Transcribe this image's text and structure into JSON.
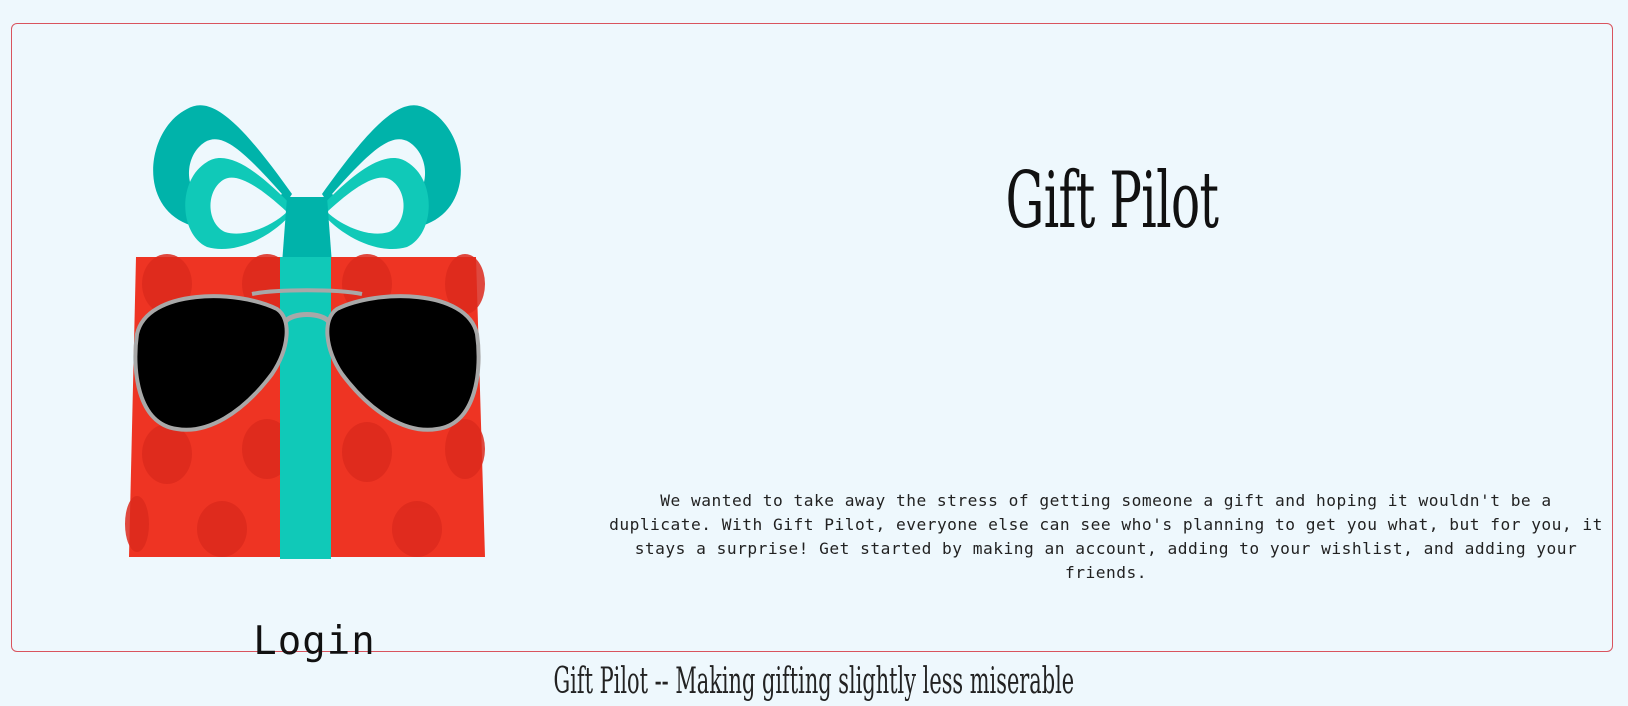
{
  "header": {
    "title": "Gift Pilot"
  },
  "main": {
    "description": "We wanted to take away the stress of getting someone a gift and hoping it wouldn't be a duplicate. With Gift Pilot, everyone else can see who's planning to get you what, but for you, it stays a surprise! Get started by making an account, adding to your wishlist, and adding your friends.",
    "login_label": "Login",
    "logo_icon": "gift-with-sunglasses-icon"
  },
  "footer": {
    "tagline": "Gift Pilot -- Making gifting slightly less miserable"
  },
  "colors": {
    "background": "#eef8fd",
    "card_border": "#d9545e",
    "box_red": "#ee3423",
    "ribbon_teal": "#10c9b8",
    "bow_dark_teal": "#00b3aa"
  }
}
